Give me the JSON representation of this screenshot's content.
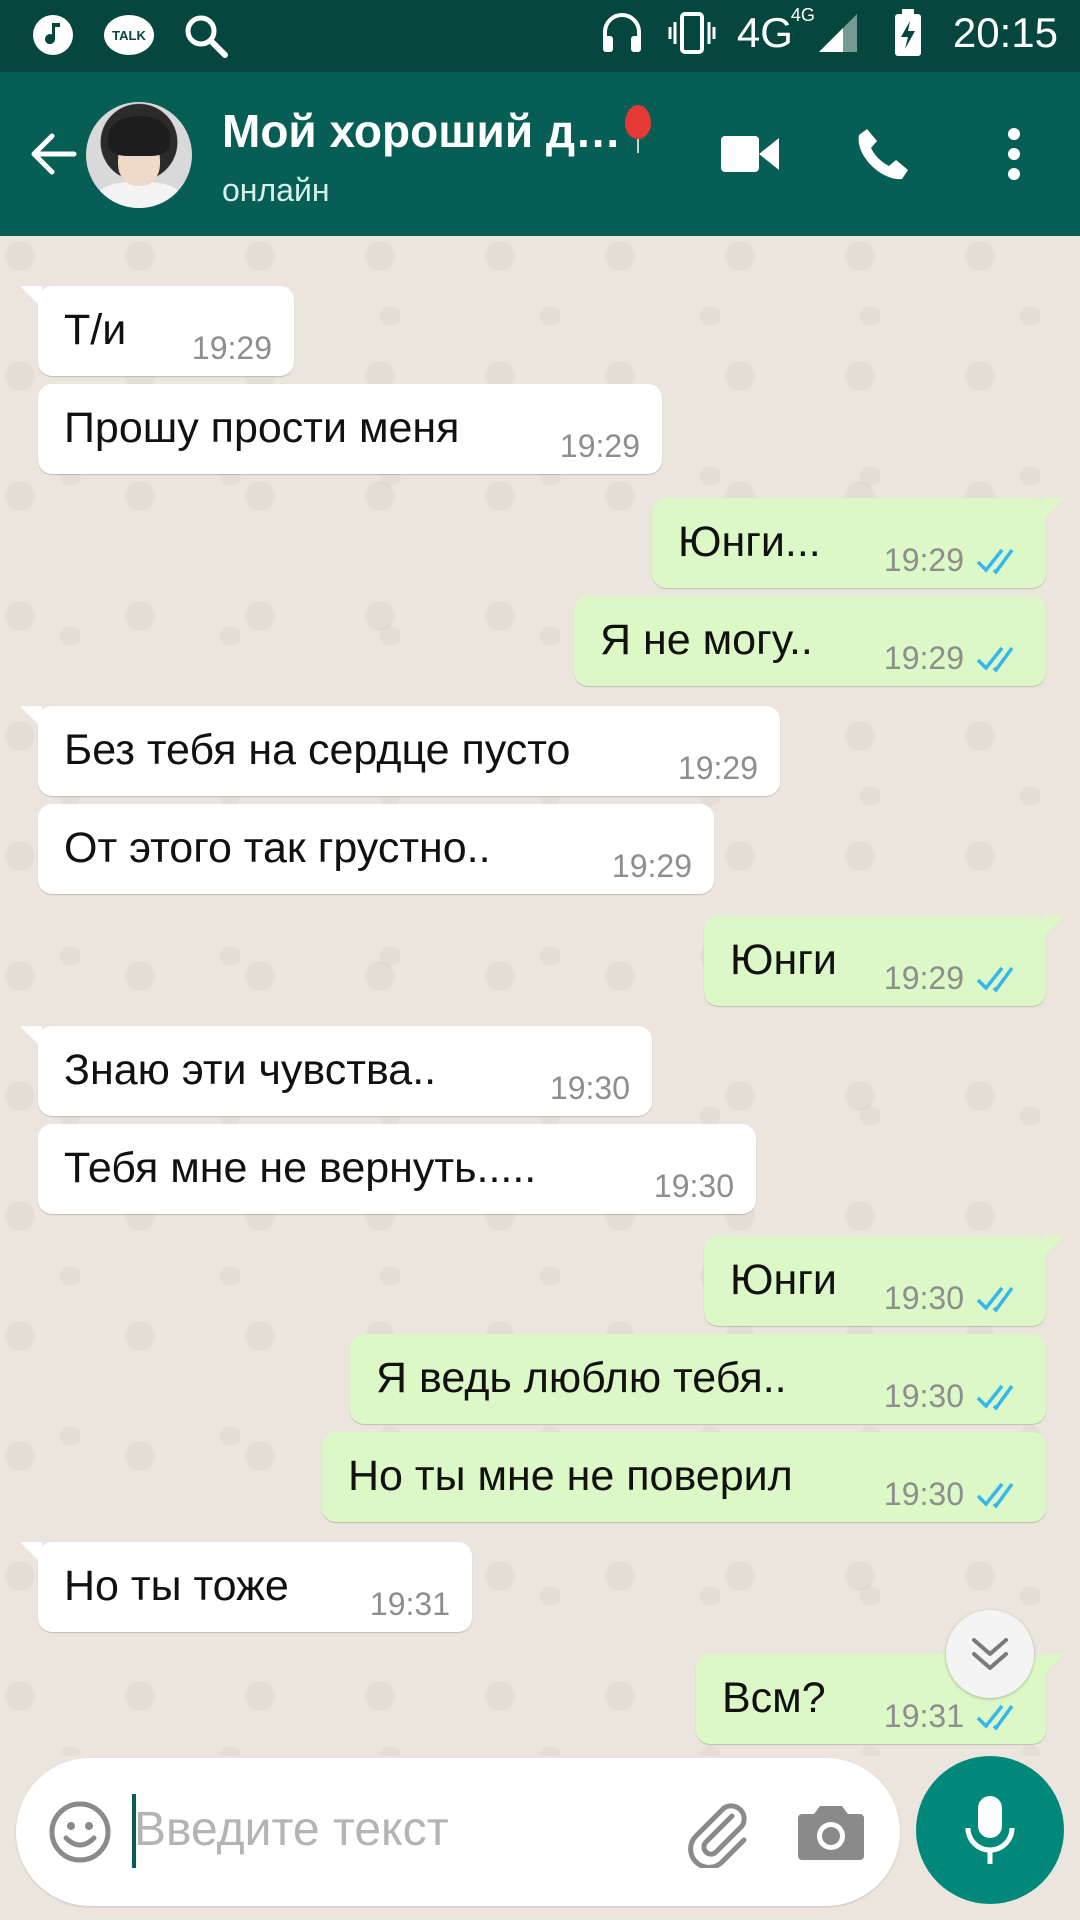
{
  "status_bar": {
    "talk_label": "TALK",
    "network": "4G",
    "network_sup": "4G",
    "time": "20:15",
    "icons": [
      "music-note-icon",
      "talk-icon",
      "search-icon",
      "headphones-icon",
      "vibrate-icon",
      "signal-icon",
      "battery-charging-icon"
    ]
  },
  "header": {
    "contact_name": "Мой хороший д…",
    "status": "онлайн",
    "icons": [
      "back-arrow-icon",
      "video-call-icon",
      "phone-icon",
      "more-vertical-icon"
    ]
  },
  "colors": {
    "status_bar": "#05463f",
    "header": "#075e54",
    "incoming": "#ffffff",
    "outgoing": "#dcf8c6",
    "read_ticks": "#34b7f1",
    "mic_button": "#00897b"
  },
  "messages": [
    {
      "dir": "in",
      "text": "Т/и",
      "time": "19:29"
    },
    {
      "dir": "in",
      "text": "Прошу прости меня",
      "time": "19:29"
    },
    {
      "dir": "out",
      "text": "Юнги...",
      "time": "19:29",
      "status": "read"
    },
    {
      "dir": "out",
      "text": "Я не могу..",
      "time": "19:29",
      "status": "read"
    },
    {
      "dir": "in",
      "text": "Без тебя на сердце пусто",
      "time": "19:29"
    },
    {
      "dir": "in",
      "text": "От этого так грустно..",
      "time": "19:29"
    },
    {
      "dir": "out",
      "text": "Юнги",
      "time": "19:29",
      "status": "read"
    },
    {
      "dir": "in",
      "text": "Знаю эти чувства..",
      "time": "19:30"
    },
    {
      "dir": "in",
      "text": "Тебя мне не вернуть.....",
      "time": "19:30"
    },
    {
      "dir": "out",
      "text": "Юнги",
      "time": "19:30",
      "status": "read"
    },
    {
      "dir": "out",
      "text": "Я ведь люблю тебя..",
      "time": "19:30",
      "status": "read"
    },
    {
      "dir": "out",
      "text": "Но ты мне не поверил",
      "time": "19:30",
      "status": "read"
    },
    {
      "dir": "in",
      "text": "Но ты тоже",
      "time": "19:31"
    },
    {
      "dir": "out",
      "text": "Всм?",
      "time": "19:31",
      "status": "read"
    }
  ],
  "input": {
    "placeholder": "Введите текст",
    "icons": [
      "emoji-icon",
      "attach-icon",
      "camera-icon",
      "mic-icon"
    ]
  }
}
